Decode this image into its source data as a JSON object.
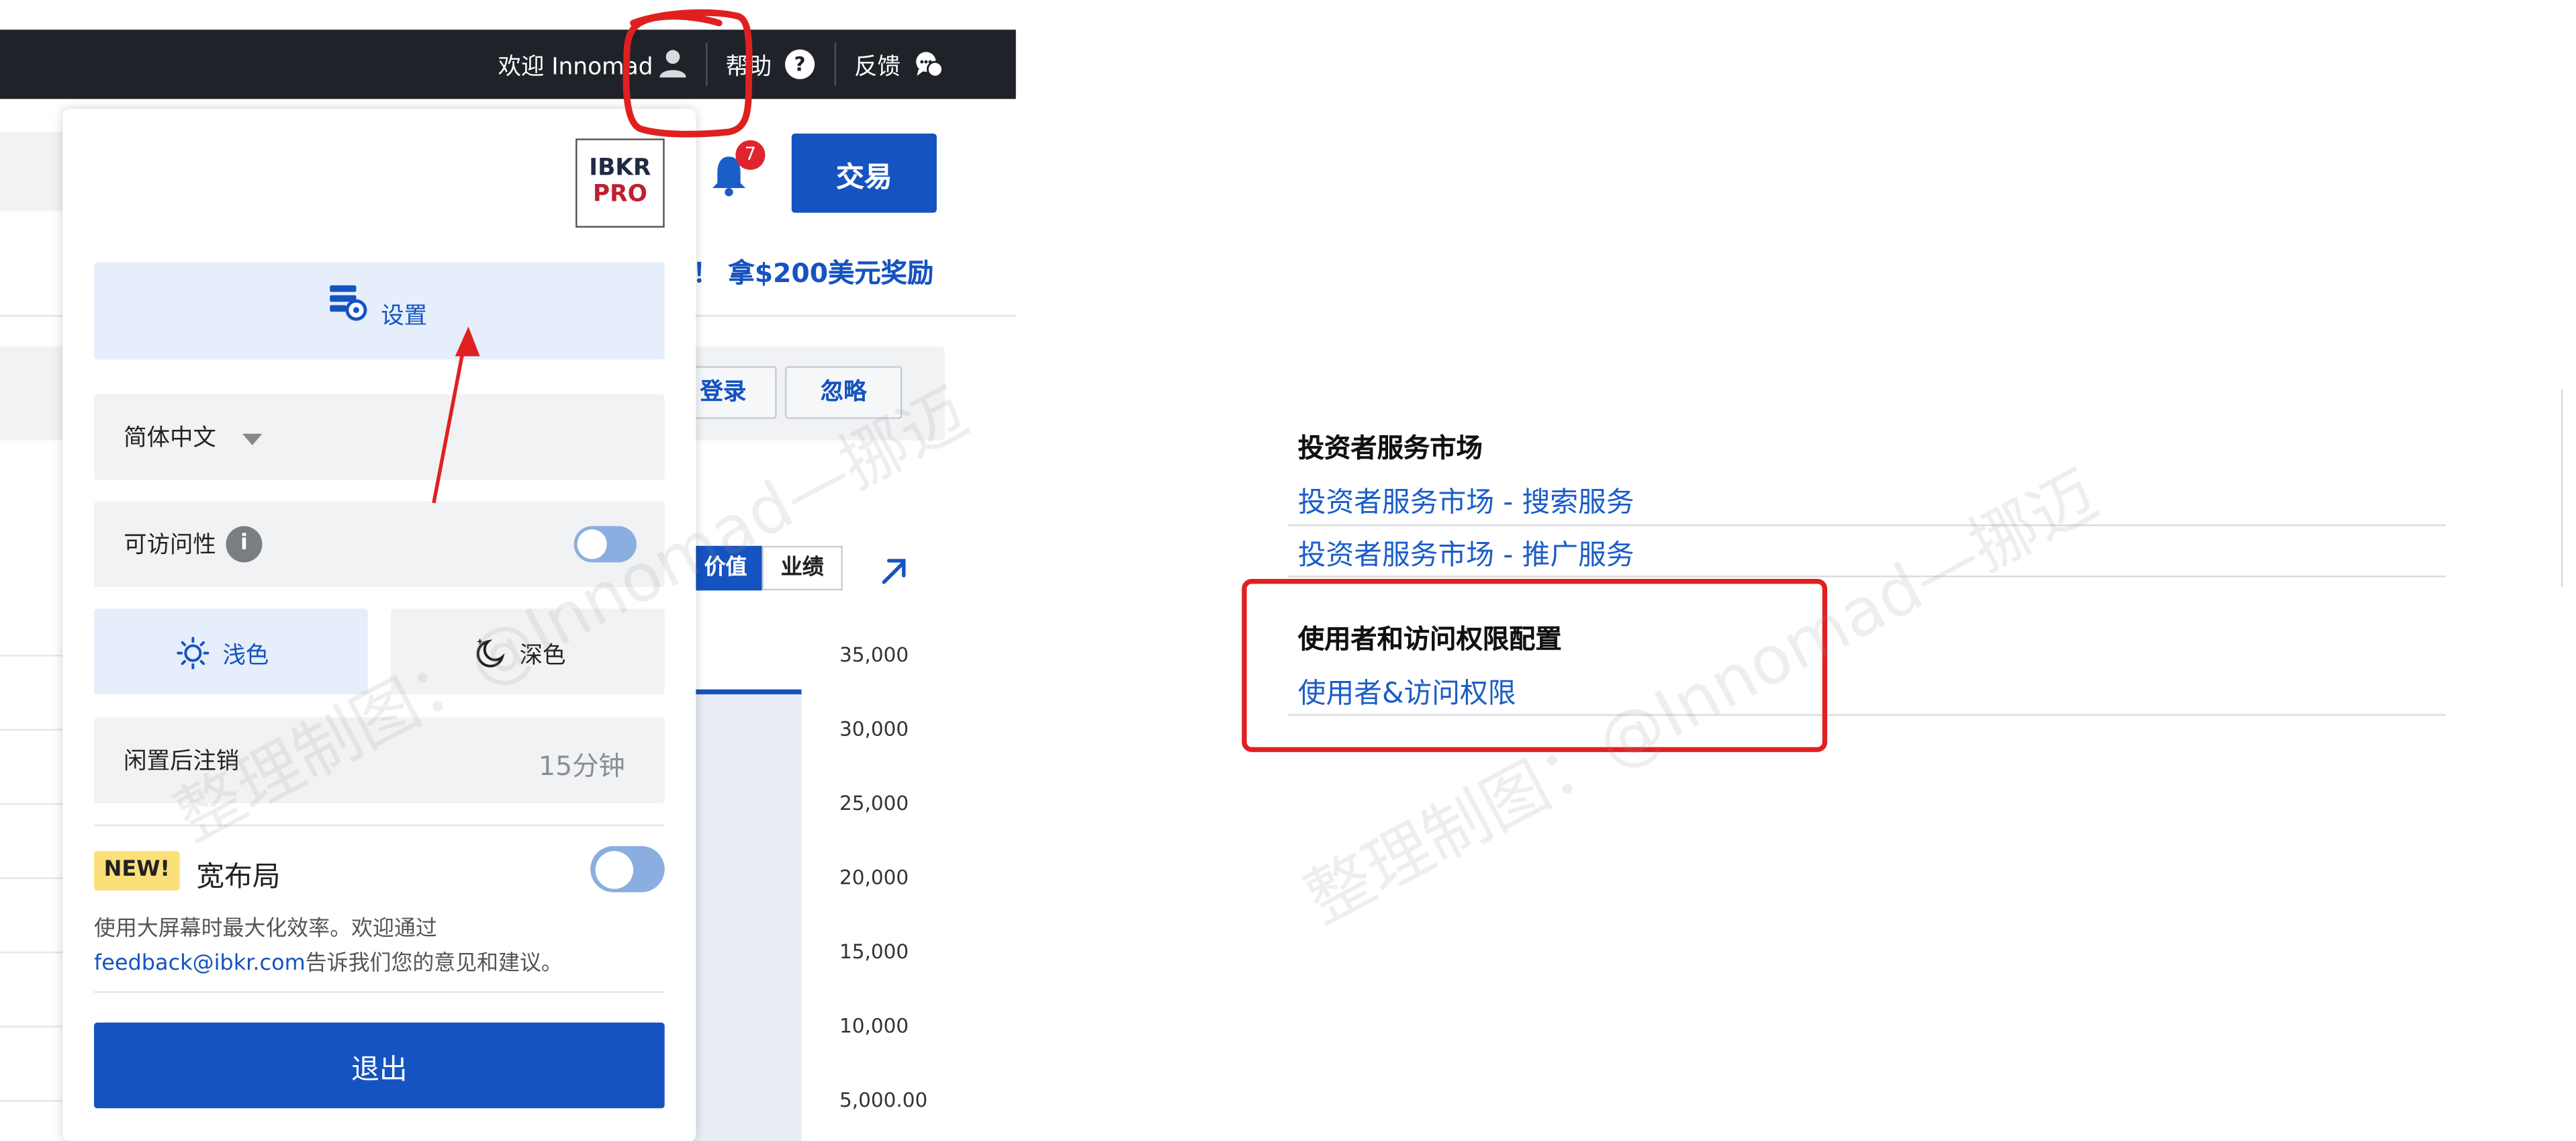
{
  "topbar": {
    "welcome": "欢迎 Innomad",
    "help": "帮助",
    "feedback": "反馈"
  },
  "header": {
    "trade_button": "交易",
    "notification_count": "7",
    "promo": "！ 拿$200美元奖励"
  },
  "notice": {
    "login_button": "登录",
    "ignore_button": "忽略"
  },
  "portfolio": {
    "tabs": [
      {
        "label": "价值",
        "active": true
      },
      {
        "label": "业绩",
        "active": false
      }
    ],
    "y_ticks": [
      "35,000",
      "30,000",
      "25,000",
      "20,000",
      "15,000",
      "10,000",
      "5,000.00"
    ]
  },
  "menu": {
    "logo_line1": "IBKR",
    "logo_line2": "PRO",
    "settings": "设置",
    "language": "简体中文",
    "accessibility": "可访问性",
    "accessibility_on": false,
    "theme_light": "浅色",
    "theme_dark": "深色",
    "theme_selected": "浅色",
    "idle_logout_label": "闲置后注销",
    "idle_logout_value": "15分钟",
    "new_badge": "NEW!",
    "wide_layout_title": "宽布局",
    "wide_layout_on": false,
    "wide_layout_desc_1": "使用大屏幕时最大化效率。欢迎通过",
    "wide_layout_email": "feedback@ibkr.com",
    "wide_layout_desc_2": "告诉我们您的意见和建议。",
    "logout": "退出"
  },
  "right_panel": {
    "sections": [
      {
        "title": "投资者服务市场",
        "links": [
          "投资者服务市场 - 搜索服务",
          "投资者服务市场 - 推广服务"
        ]
      },
      {
        "title": "使用者和访问权限配置",
        "links": [
          "使用者&访问权限"
        ]
      }
    ]
  },
  "watermark": "整理制图：@Innomad—挪迈",
  "colors": {
    "accent_blue": "#1553c0",
    "annotation_red": "#e02020",
    "topbar_dark": "#1f2329",
    "badge_red": "#e0242f",
    "new_badge_yellow": "#fbe07a"
  },
  "icons": [
    "user-icon",
    "help-icon",
    "feedback-icon",
    "bell-icon",
    "settings-icon",
    "info-icon",
    "sun-icon",
    "moon-icon",
    "expand-arrow-icon"
  ]
}
